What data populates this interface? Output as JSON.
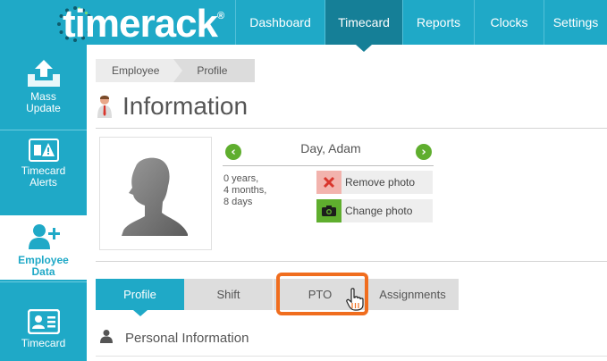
{
  "app": {
    "logo_text": "timerack",
    "logo_reg": "®"
  },
  "nav": {
    "items": [
      {
        "label": "Dashboard",
        "active": false
      },
      {
        "label": "Timecard",
        "active": true
      },
      {
        "label": "Reports",
        "active": false
      },
      {
        "label": "Clocks",
        "active": false
      },
      {
        "label": "Settings",
        "active": false
      }
    ]
  },
  "sidebar": {
    "items": [
      {
        "label_line1": "Mass",
        "label_line2": "Update",
        "icon": "upload-tray-icon"
      },
      {
        "label_line1": "Timecard",
        "label_line2": "Alerts",
        "icon": "alert-card-icon"
      },
      {
        "label_line1": "Employee",
        "label_line2": "Data",
        "icon": "add-person-icon",
        "active": true
      },
      {
        "label_line1": "Timecard",
        "label_line2": "",
        "icon": "id-card-icon"
      }
    ]
  },
  "breadcrumb": {
    "items": [
      "Employee",
      "Profile"
    ]
  },
  "page": {
    "title": "Information",
    "title_icon": "employee-person-icon"
  },
  "employee": {
    "name": "Day, Adam",
    "tenure_years": "0 years,",
    "tenure_months": "4 months,",
    "tenure_days": "8 days",
    "remove_photo_label": "Remove photo",
    "change_photo_label": "Change photo"
  },
  "tabs": {
    "items": [
      {
        "label": "Profile",
        "active": true
      },
      {
        "label": "Shift",
        "active": false
      },
      {
        "label": "PTO",
        "active": false,
        "highlighted": true
      },
      {
        "label": "Assignments",
        "active": false
      }
    ]
  },
  "section": {
    "personal_info_label": "Personal Information"
  },
  "colors": {
    "brand": "#1fa9c7",
    "brand_dark": "#157f97",
    "highlight": "#f06d1e",
    "green": "#5fae2e",
    "danger": "#e84c3d"
  }
}
